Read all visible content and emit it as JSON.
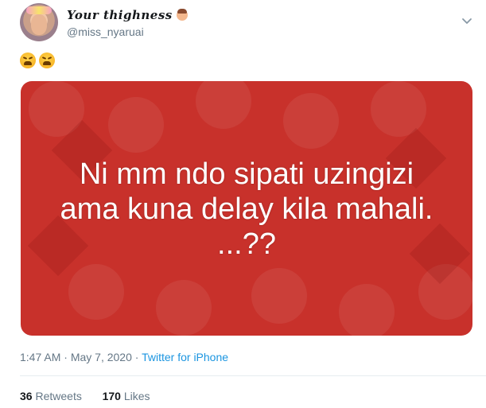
{
  "author": {
    "display_name": "Your thighness",
    "handle": "@miss_nyaruai"
  },
  "tweet": {
    "text_emojis": "😩😩",
    "image_text": {
      "line1": "Ni mm ndo sipati uzingizi",
      "line2": "ama kuna delay kila mahali.",
      "line3": "...??"
    },
    "time": "1:47 AM",
    "date": "May 7, 2020",
    "dot": "·",
    "source": "Twitter for iPhone"
  },
  "stats": {
    "retweets_count": "36",
    "retweets_label": "Retweets",
    "likes_count": "170",
    "likes_label": "Likes"
  },
  "colors": {
    "accent": "#1b95e0",
    "image_background": "#c8312b",
    "muted_text": "#657786"
  }
}
